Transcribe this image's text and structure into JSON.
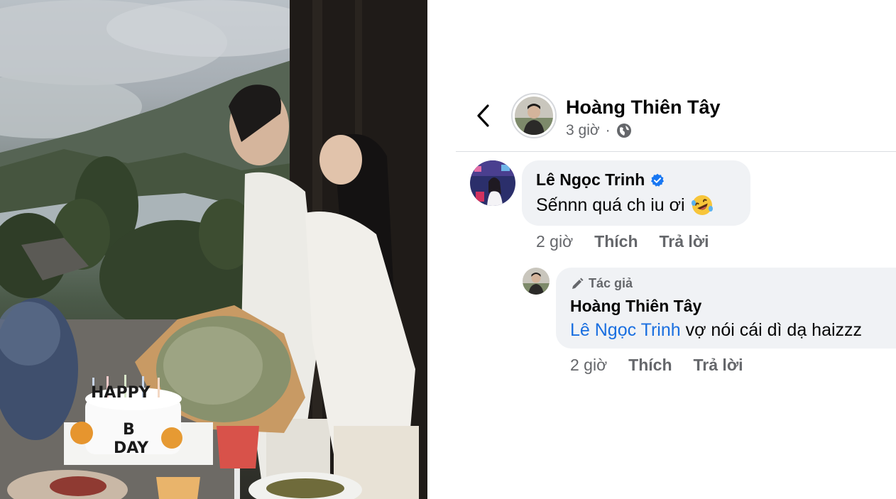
{
  "post": {
    "author": "Hoàng Thiên Tây",
    "time": "3 giờ",
    "privacy_icon": "globe-icon"
  },
  "comment": {
    "author": "Lê Ngọc Trinh",
    "verified_icon": "verified-badge-icon",
    "text": "Sếnnn quá ch iu ơi",
    "emoji": "rolling-on-floor-laughing-emoji",
    "time": "2 giờ",
    "like_label": "Thích",
    "reply_label": "Trả lời"
  },
  "reply": {
    "badge": "Tác giả",
    "author": "Hoàng Thiên Tây",
    "mention": "Lê Ngọc Trinh",
    "text": " vợ nói cái dì dạ haizzz",
    "time": "2 giờ",
    "like_label": "Thích",
    "reply_label": "Trả lời"
  },
  "photo": {
    "cake_text_1": "HAPPY",
    "cake_text_2": "B",
    "cake_text_3": "DAY"
  },
  "colors": {
    "accent_blue": "#1a6fe0",
    "bubble_bg": "#f0f2f5",
    "meta_gray": "#65676b"
  }
}
